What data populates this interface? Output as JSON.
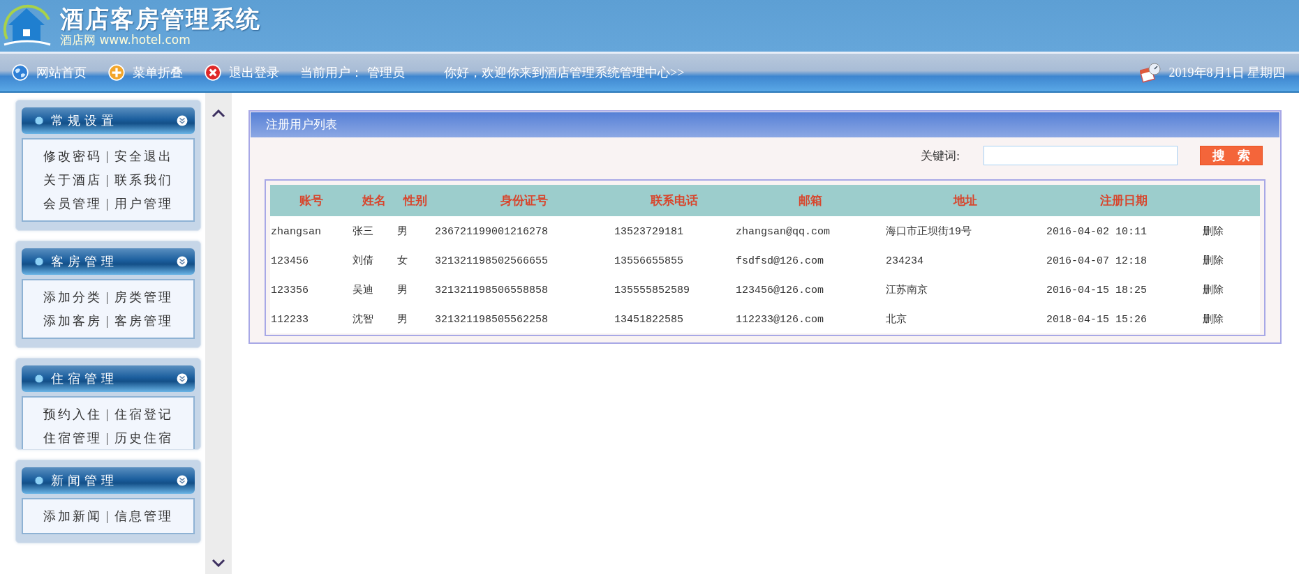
{
  "header": {
    "title": "酒店客房管理系统",
    "subtitle": "酒店网 www.hotel.com"
  },
  "nav": {
    "items": [
      {
        "kind": "globe",
        "label": "网站首页"
      },
      {
        "kind": "plus",
        "label": "菜单折叠"
      },
      {
        "kind": "close",
        "label": "退出登录"
      }
    ],
    "user_label": "当前用户：",
    "user_name": "管理员",
    "welcome": "你好，欢迎你来到酒店管理系统管理中心>>",
    "date": "2019年8月1日  星期四"
  },
  "sidebar": {
    "panels": [
      {
        "title": "常规设置",
        "rows": [
          {
            "left": "修改密码",
            "separator": "|",
            "right": "安全退出"
          },
          {
            "left": "关于酒店",
            "separator": "|",
            "right": "联系我们"
          },
          {
            "left": "会员管理",
            "separator": "|",
            "right": "用户管理"
          }
        ]
      },
      {
        "title": "客房管理",
        "rows": [
          {
            "left": "添加分类",
            "separator": "|",
            "right": "房类管理"
          },
          {
            "left": "添加客房",
            "separator": "|",
            "right": "客房管理"
          }
        ]
      },
      {
        "title": "住宿管理",
        "rows": [
          {
            "left": "预约入住",
            "separator": "|",
            "right": "住宿登记"
          },
          {
            "left": "住宿管理",
            "separator": "|",
            "right": "历史住宿"
          }
        ]
      },
      {
        "title": "新闻管理",
        "rows": [
          {
            "left": "添加新闻",
            "separator": "|",
            "right": "信息管理"
          }
        ]
      }
    ]
  },
  "main": {
    "title": "注册用户列表",
    "search": {
      "label": "关键词:",
      "button": "搜　索"
    },
    "table": {
      "columns": [
        "账号",
        "姓名",
        "性别",
        "身份证号",
        "联系电话",
        "邮箱",
        "地址",
        "注册日期"
      ],
      "rows": [
        {
          "cells": [
            "zhangsan",
            "张三",
            "男",
            "236721199001216278",
            "13523729181",
            "zhangsan@qq.com",
            "海口市正坝街19号",
            "2016-04-02 10:11"
          ],
          "action": "删除"
        },
        {
          "cells": [
            "123456",
            "刘倩",
            "女",
            "321321198502566655",
            "13556655855",
            "fsdfsd@126.com",
            "234234",
            "2016-04-07 12:18"
          ],
          "action": "删除"
        },
        {
          "cells": [
            "123356",
            "吴迪",
            "男",
            "321321198506558858",
            "135555852589",
            "123456@126.com",
            "江苏南京",
            "2016-04-15 18:25"
          ],
          "action": "删除"
        },
        {
          "cells": [
            "112233",
            "沈智",
            "男",
            "321321198505562258",
            "13451822585",
            "112233@126.com",
            "北京",
            "2018-04-15 15:26"
          ],
          "action": "删除"
        }
      ]
    }
  }
}
